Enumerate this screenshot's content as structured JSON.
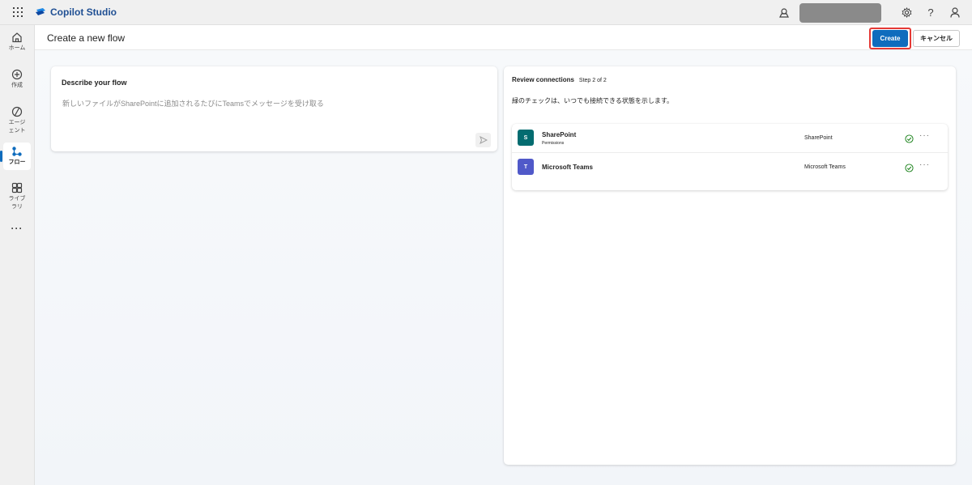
{
  "app": {
    "title": "Copilot Studio"
  },
  "rail": {
    "items": [
      {
        "id": "home",
        "label": "ホーム"
      },
      {
        "id": "create",
        "label": "作成"
      },
      {
        "id": "agents",
        "label_line1": "エージ",
        "label_line2": "ェント"
      },
      {
        "id": "flows",
        "label": "フロー"
      },
      {
        "id": "library",
        "label_line1": "ライブ",
        "label_line2": "ラリ"
      },
      {
        "id": "more",
        "label": "···"
      }
    ]
  },
  "header": {
    "title": "Create a new flow",
    "create_label": "Create",
    "cancel_label": "キャンセル"
  },
  "describe": {
    "title": "Describe your flow",
    "prompt_text": "新しいファイルがSharePointに追加されるたびにTeamsでメッセージを受け取る"
  },
  "review": {
    "title": "Review connections",
    "step": "Step 2 of 2",
    "description": "緑のチェックは、いつでも接続できる状態を示します。",
    "connections": [
      {
        "name": "SharePoint",
        "sub": "Permissions",
        "type": "SharePoint",
        "status": "connected",
        "color": "#036c70"
      },
      {
        "name": "Microsoft Teams",
        "sub": "",
        "type": "Microsoft Teams",
        "status": "connected",
        "color": "#5059c9"
      }
    ]
  },
  "colors": {
    "accent": "#0f6cbd",
    "check": "#107c10",
    "focus": "#e53935"
  }
}
